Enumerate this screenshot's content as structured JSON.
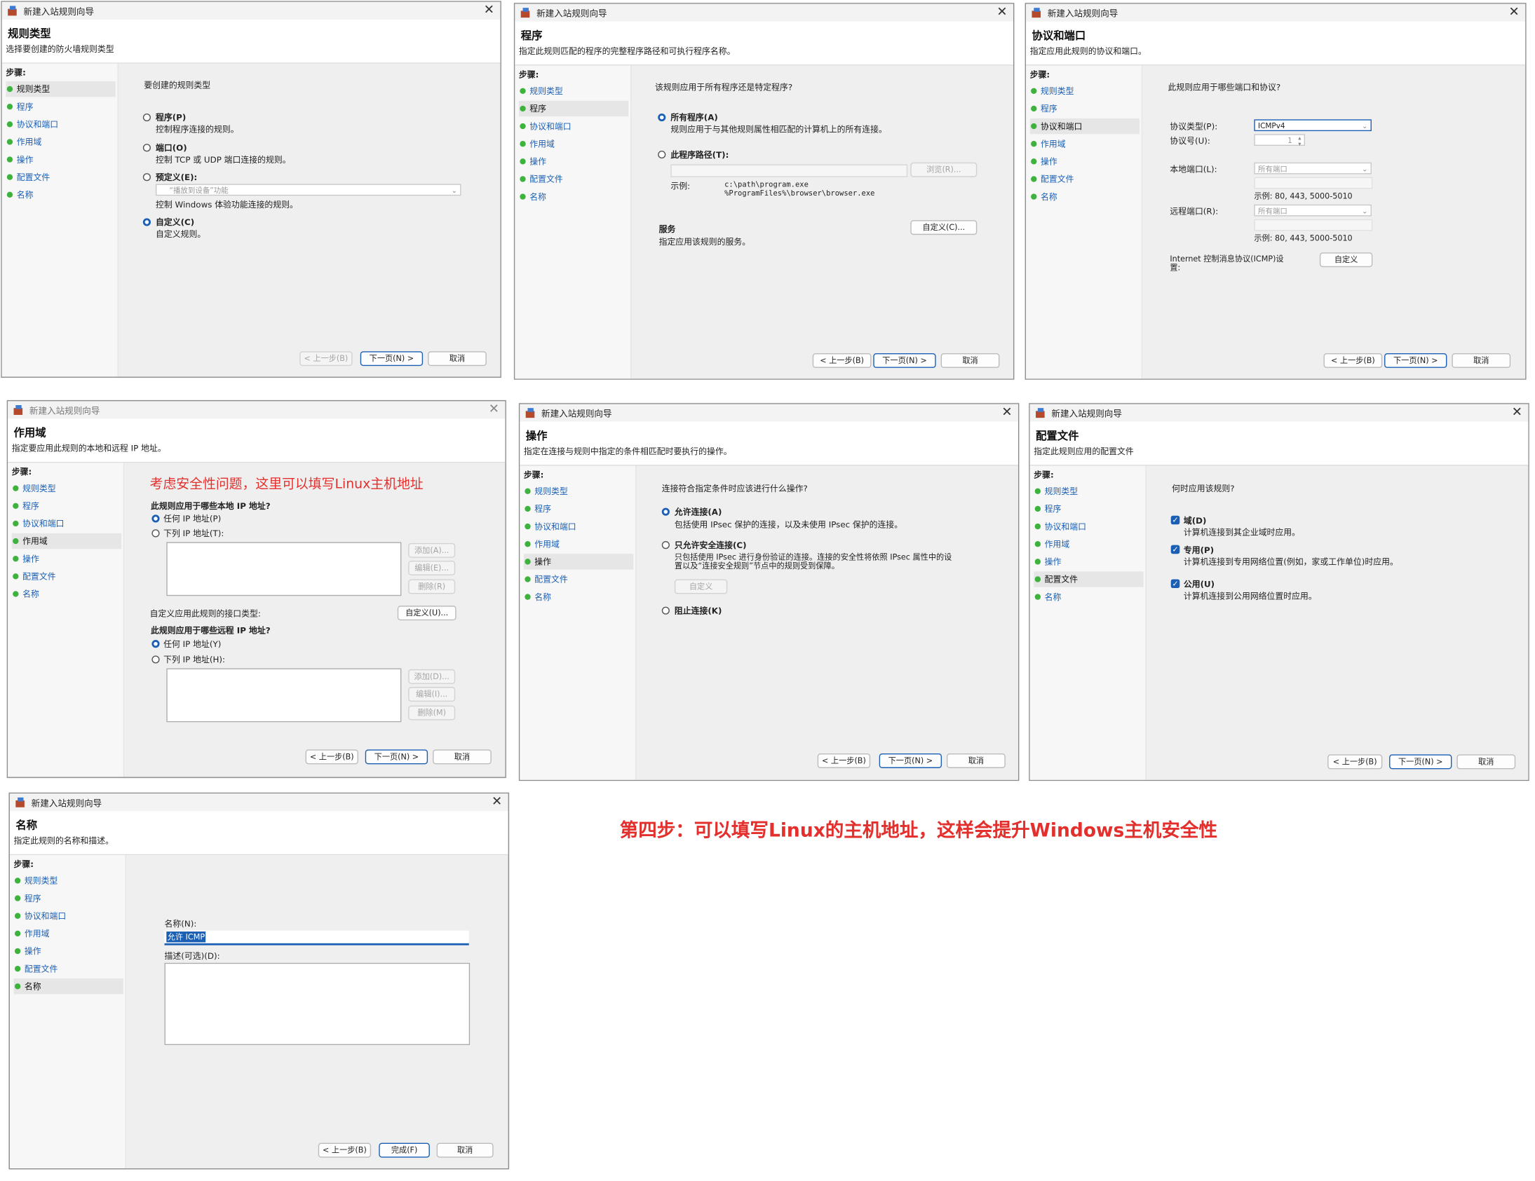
{
  "wizard_title": "新建入站规则向导",
  "steps_header": "步骤:",
  "steps": [
    "规则类型",
    "程序",
    "协议和端口",
    "作用域",
    "操作",
    "配置文件",
    "名称"
  ],
  "buttons": {
    "back": "< 上一步(B)",
    "next": "下一页(N) >",
    "cancel": "取消",
    "finish": "完成(F)"
  },
  "panel1": {
    "title": "规则类型",
    "subtitle": "选择要创建的防火墙规则类型",
    "question": "要创建的规则类型",
    "options": [
      {
        "label": "程序(P)",
        "desc": "控制程序连接的规则。"
      },
      {
        "label": "端口(O)",
        "desc": "控制 TCP 或 UDP 端口连接的规则。"
      },
      {
        "label": "预定义(E):",
        "desc": "控制 Windows 体验功能连接的规则。"
      },
      {
        "label": "自定义(C)",
        "desc": "自定义规则。"
      }
    ],
    "predefined_value": "“播放到设备”功能"
  },
  "panel2": {
    "title": "程序",
    "subtitle": "指定此规则匹配的程序的完整程序路径和可执行程序名称。",
    "question": "该规则应用于所有程序还是特定程序?",
    "all_label": "所有程序(A)",
    "all_desc": "规则应用于与其他规则属性相匹配的计算机上的所有连接。",
    "path_label": "此程序路径(T):",
    "browse": "浏览(R)...",
    "example_label": "示例:",
    "example_1": "c:\\path\\program.exe",
    "example_2": "%ProgramFiles%\\browser\\browser.exe",
    "services_title": "服务",
    "services_desc": "指定应用该规则的服务。",
    "customize": "自定义(C)..."
  },
  "panel3": {
    "title": "协议和端口",
    "subtitle": "指定应用此规则的协议和端口。",
    "question": "此规则应用于哪些端口和协议?",
    "protocol_type_label": "协议类型(P):",
    "protocol_type_value": "ICMPv4",
    "protocol_num_label": "协议号(U):",
    "protocol_num_value": "1",
    "local_port_label": "本地端口(L):",
    "local_port_value": "所有端口",
    "remote_port_label": "远程端口(R):",
    "remote_port_value": "所有端口",
    "port_example": "示例: 80, 443, 5000-5010",
    "icmp_label_1": "Internet 控制消息协议(ICMP)设",
    "icmp_label_2": "置:",
    "icmp_button": "自定义"
  },
  "panel4": {
    "title": "作用域",
    "subtitle": "指定要应用此规则的本地和远程 IP 地址。",
    "annotation": "考虑安全性问题，这里可以填写Linux主机地址",
    "local_q": "此规则应用于哪些本地 IP 地址?",
    "local_any": "任何 IP 地址(P)",
    "local_list": "下列 IP 地址(T):",
    "add1": "添加(A)...",
    "edit1": "编辑(E)...",
    "del1": "删除(R)",
    "iface_label": "自定义应用此规则的接口类型:",
    "iface_btn": "自定义(U)...",
    "remote_q": "此规则应用于哪些远程 IP 地址?",
    "remote_any": "任何 IP 地址(Y)",
    "remote_list": "下列 IP 地址(H):",
    "add2": "添加(D)...",
    "edit2": "编辑(I)...",
    "del2": "删除(M)"
  },
  "panel5": {
    "title": "操作",
    "subtitle": "指定在连接与规则中指定的条件相匹配时要执行的操作。",
    "question": "连接符合指定条件时应该进行什么操作?",
    "allow_label": "允许连接(A)",
    "allow_desc": "包括使用 IPsec 保护的连接，以及未使用 IPsec 保护的连接。",
    "secure_label": "只允许安全连接(C)",
    "secure_desc_1": "只包括使用 IPsec 进行身份验证的连接。连接的安全性将依照 IPsec 属性中的设",
    "secure_desc_2": "置以及“连接安全规则”节点中的规则受到保障。",
    "secure_btn": "自定义",
    "block_label": "阻止连接(K)"
  },
  "panel6": {
    "title": "配置文件",
    "subtitle": "指定此规则应用的配置文件",
    "question": "何时应用该规则?",
    "domain_label": "域(D)",
    "domain_desc": "计算机连接到其企业域时应用。",
    "private_label": "专用(P)",
    "private_desc": "计算机连接到专用网络位置(例如，家或工作单位)时应用。",
    "public_label": "公用(U)",
    "public_desc": "计算机连接到公用网络位置时应用。"
  },
  "panel7": {
    "title": "名称",
    "subtitle": "指定此规则的名称和描述。",
    "name_label": "名称(N):",
    "name_value": "允许 ICMP",
    "desc_label": "描述(可选)(D):"
  },
  "caption": "第四步：可以填写Linux的主机地址，这样会提升Windows主机安全性"
}
